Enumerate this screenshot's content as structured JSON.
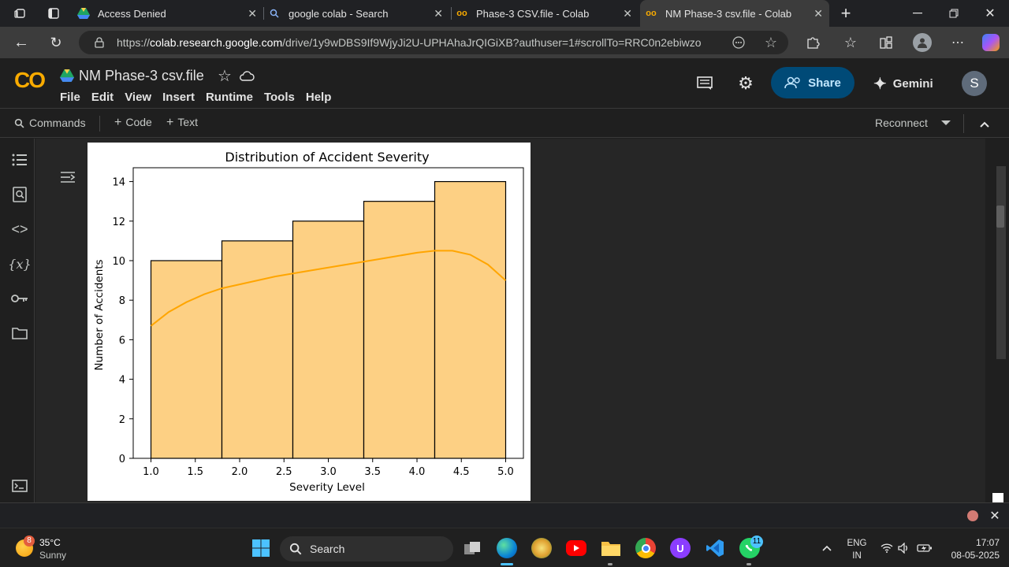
{
  "browser": {
    "tabs": [
      {
        "title": "Access Denied",
        "icon": "google-drive-icon"
      },
      {
        "title": "google colab - Search",
        "icon": "search-icon"
      },
      {
        "title": "Phase-3 CSV.file - Colab",
        "icon": "colab-icon"
      },
      {
        "title": "NM Phase-3 csv.file - Colab",
        "icon": "colab-icon",
        "active": true
      }
    ],
    "url_prefix": "https://",
    "url_host": "colab.research.google.com",
    "url_path": "/drive/1y9wDBS9If9WjyJi2U-UPHAhaJrQIGiXB?authuser=1#scrollTo=RRC0n2ebiwzo"
  },
  "colab": {
    "logo": "CO",
    "notebook_title": "NM Phase-3 csv.file",
    "menu": [
      "File",
      "Edit",
      "View",
      "Insert",
      "Runtime",
      "Tools",
      "Help"
    ],
    "share_label": "Share",
    "gemini_label": "Gemini",
    "avatar_letter": "S",
    "toolbar": {
      "commands": "Commands",
      "code": "Code",
      "text": "Text",
      "reconnect": "Reconnect"
    }
  },
  "chart_data": {
    "type": "bar",
    "title": "Distribution of Accident Severity",
    "xlabel": "Severity Level",
    "ylabel": "Number of Accidents",
    "bins": [
      [
        1.0,
        1.8
      ],
      [
        1.8,
        2.6
      ],
      [
        2.6,
        3.4
      ],
      [
        3.4,
        4.2
      ],
      [
        4.2,
        5.0
      ]
    ],
    "values": [
      10,
      11,
      12,
      13,
      14
    ],
    "xlim": [
      0.8,
      5.2
    ],
    "ylim": [
      0,
      14.7
    ],
    "xticks": [
      "1.0",
      "1.5",
      "2.0",
      "2.5",
      "3.0",
      "3.5",
      "4.0",
      "4.5",
      "5.0"
    ],
    "xtick_values": [
      1.0,
      1.5,
      2.0,
      2.5,
      3.0,
      3.5,
      4.0,
      4.5,
      5.0
    ],
    "yticks": [
      "0",
      "2",
      "4",
      "6",
      "8",
      "10",
      "12",
      "14"
    ],
    "ytick_values": [
      0,
      2,
      4,
      6,
      8,
      10,
      12,
      14
    ],
    "kde": {
      "x": [
        1.0,
        1.2,
        1.4,
        1.6,
        1.8,
        2.0,
        2.4,
        2.8,
        3.2,
        3.6,
        4.0,
        4.2,
        4.4,
        4.6,
        4.8,
        5.0
      ],
      "y": [
        6.7,
        7.4,
        7.9,
        8.3,
        8.6,
        8.8,
        9.2,
        9.5,
        9.8,
        10.1,
        10.4,
        10.5,
        10.5,
        10.3,
        9.8,
        9.0
      ]
    },
    "bar_color": "#fdd084",
    "kde_color": "#ffa500",
    "grid": false
  },
  "taskbar": {
    "weather_temp": "35°C",
    "weather_desc": "Sunny",
    "weather_badge": "8",
    "search_label": "Search",
    "whatsapp_badge": "11",
    "lang_top": "ENG",
    "lang_bottom": "IN",
    "time": "17:07",
    "date": "08-05-2025"
  }
}
